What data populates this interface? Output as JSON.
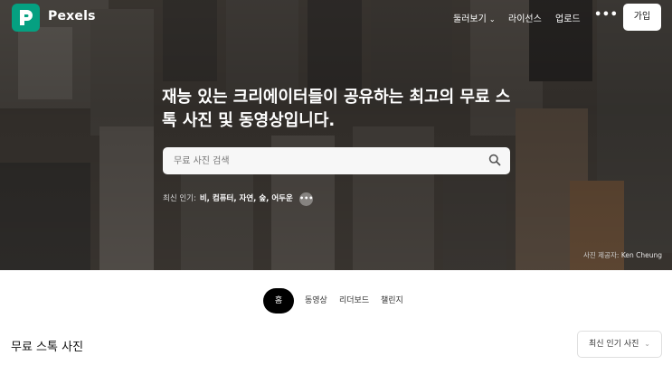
{
  "nav": {
    "brand": "Pexels",
    "browse": "둘러보기",
    "license": "라이선스",
    "upload": "업로드",
    "more": "•••",
    "join": "가입"
  },
  "hero": {
    "headline": "재능 있는 크리에이터들이 공유하는 최고의 무료 스톡 사진 및 동영상입니다.",
    "search_placeholder": "무료 사진 검색",
    "trending_label": "최신 인기:",
    "trending_items": "비, 컴퓨터, 자연, 숲, 어두운",
    "trending_more": "•••",
    "credit_label": "사진 제공자:",
    "credit_author": "Ken Cheung"
  },
  "tabs": [
    {
      "label": "홈",
      "active": true
    },
    {
      "label": "동영상",
      "active": false
    },
    {
      "label": "리더보드",
      "active": false
    },
    {
      "label": "챌린지",
      "active": false
    }
  ],
  "section": {
    "title": "무료 스톡 사진",
    "sort_label": "최신 인기 사진"
  },
  "colors": {
    "brand": "#05a081",
    "tab_active_bg": "#000000"
  }
}
